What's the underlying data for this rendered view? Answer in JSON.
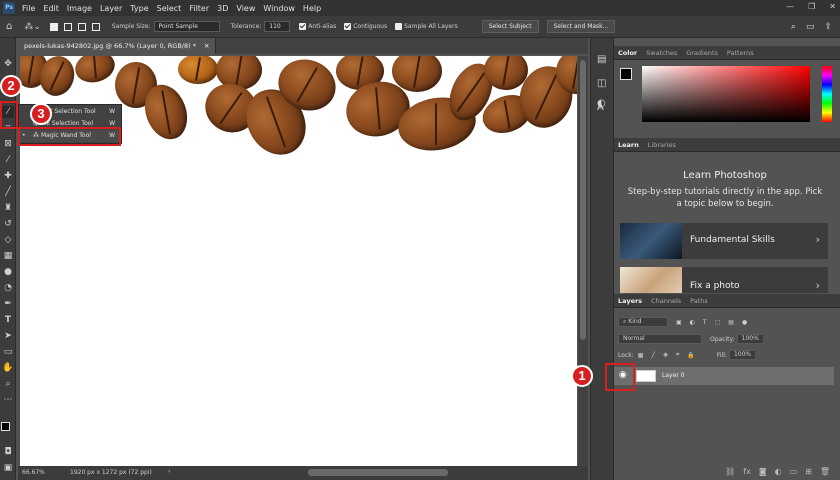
{
  "menubar": {
    "app_icon": "Ps",
    "items": [
      "File",
      "Edit",
      "Image",
      "Layer",
      "Type",
      "Select",
      "Filter",
      "3D",
      "View",
      "Window",
      "Help"
    ],
    "window_controls": [
      "minimize-icon",
      "restore-icon",
      "close-icon"
    ]
  },
  "options_bar": {
    "sample_size_label": "Sample Size:",
    "sample_size_value": "Point Sample",
    "tolerance_label": "Tolerance:",
    "tolerance_value": "110",
    "anti_alias_label": "Anti-alias",
    "contiguous_label": "Contiguous",
    "sample_all_layers_label": "Sample All Layers",
    "select_subject_label": "Select Subject",
    "select_mask_label": "Select and Mask..."
  },
  "document": {
    "tab_title": "pexels-lukas-942802.jpg @ 66.7% (Layer 0, RGB/8) *",
    "zoom": "66.67%",
    "dimensions": "1920 px x 1272 px (72 ppi)"
  },
  "tool_flyout": {
    "items": [
      {
        "label": "Object Selection Tool",
        "key": "W"
      },
      {
        "label": "Quick Selection Tool",
        "key": "W"
      },
      {
        "label": "Magic Wand Tool",
        "key": "W"
      }
    ]
  },
  "callouts": [
    "1",
    "2",
    "3"
  ],
  "color_panel": {
    "tabs": [
      "Color",
      "Swatches",
      "Gradients",
      "Patterns"
    ],
    "active_tab": "Color"
  },
  "learn_panel": {
    "tabs": [
      "Learn",
      "Libraries"
    ],
    "title": "Learn Photoshop",
    "subtitle": "Step-by-step tutorials directly in the app. Pick a topic below to begin.",
    "cards": [
      "Fundamental Skills",
      "Fix a photo"
    ]
  },
  "layers_panel": {
    "tabs": [
      "Layers",
      "Channels",
      "Paths"
    ],
    "filter_kind": "Kind",
    "blend_mode": "Normal",
    "opacity_label": "Opacity:",
    "opacity_value": "100%",
    "lock_label": "Lock:",
    "fill_label": "Fill:",
    "fill_value": "100%",
    "layer_name": "Layer 0"
  }
}
